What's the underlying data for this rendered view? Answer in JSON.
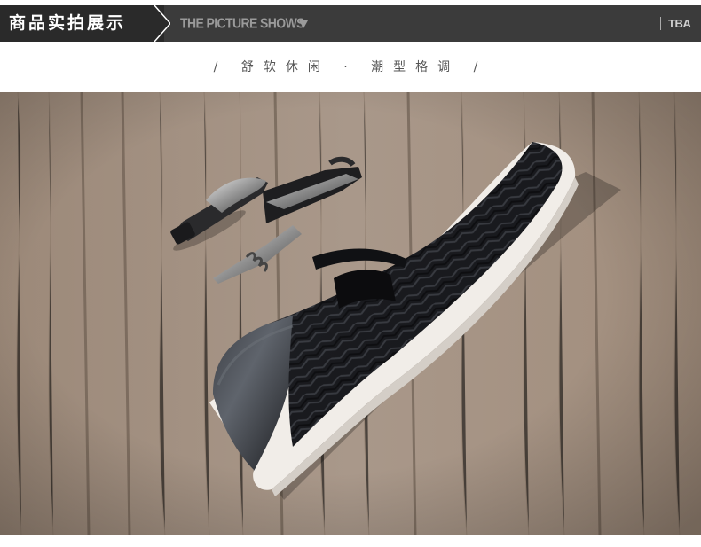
{
  "header": {
    "title_cn": "商品实拍展示",
    "title_en": "THE PICTURE SHOWS",
    "brand": "TBA",
    "down_icon": "chevron-down-icon"
  },
  "tagline": "/ 舒软休闲 · 潮型格调 /",
  "photo": {
    "subject": "product-photo",
    "colors": {
      "wood": "#a08d7d",
      "shoe_upper": "#1c1d20",
      "sole": "#f1ede8",
      "metal": "#b9b9b9"
    }
  }
}
